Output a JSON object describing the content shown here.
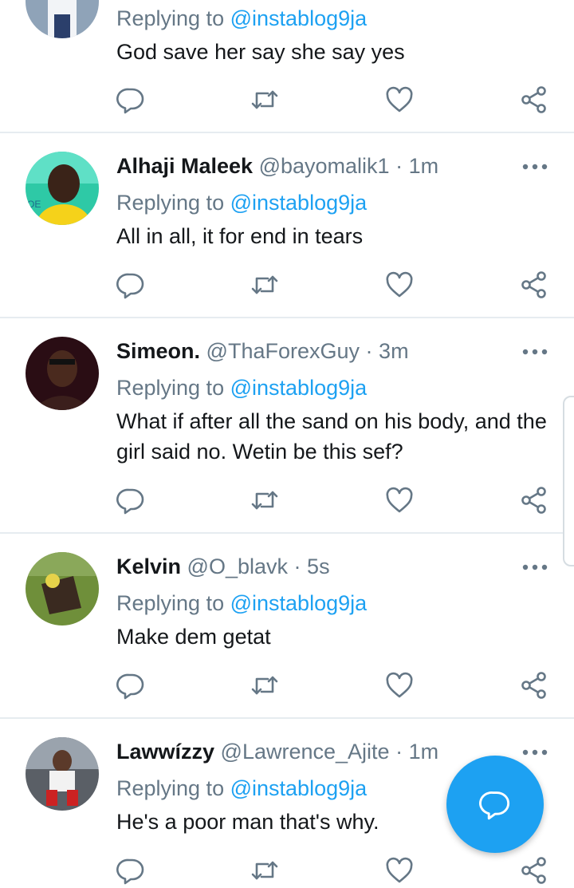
{
  "colors": {
    "accent": "#1da1f2",
    "secondary_text": "#657786",
    "divider": "#e6ecf0"
  },
  "tweets": [
    {
      "name": "",
      "handle": "",
      "time": "",
      "replying_label": "Replying to",
      "replying_to": "@instablog9ja",
      "text": "God save her say she say yes"
    },
    {
      "name": "Alhaji Maleek",
      "handle": "@bayomalik1",
      "time": "1m",
      "replying_label": "Replying to",
      "replying_to": "@instablog9ja",
      "text": "All in all, it for end in tears"
    },
    {
      "name": "Simeon.",
      "handle": "@ThaForexGuy",
      "time": "3m",
      "replying_label": "Replying to",
      "replying_to": "@instablog9ja",
      "text": "What if after all the sand on his body, and the girl said no. Wetin be this sef?"
    },
    {
      "name": "Kelvin",
      "handle": "@O_blavk",
      "time": "5s",
      "replying_label": "Replying to",
      "replying_to": "@instablog9ja",
      "text": "Make dem getat"
    },
    {
      "name": "Lawwízzy",
      "handle": "@Lawrence_Ajite",
      "time": "1m",
      "replying_label": "Replying to",
      "replying_to": "@instablog9ja",
      "text": "He's a poor man that's why."
    }
  ],
  "separator": "·",
  "icons": {
    "reply": "reply-icon",
    "retweet": "retweet-icon",
    "like": "heart-icon",
    "share": "share-icon",
    "more": "more-options-icon",
    "compose": "compose-reply-icon"
  }
}
